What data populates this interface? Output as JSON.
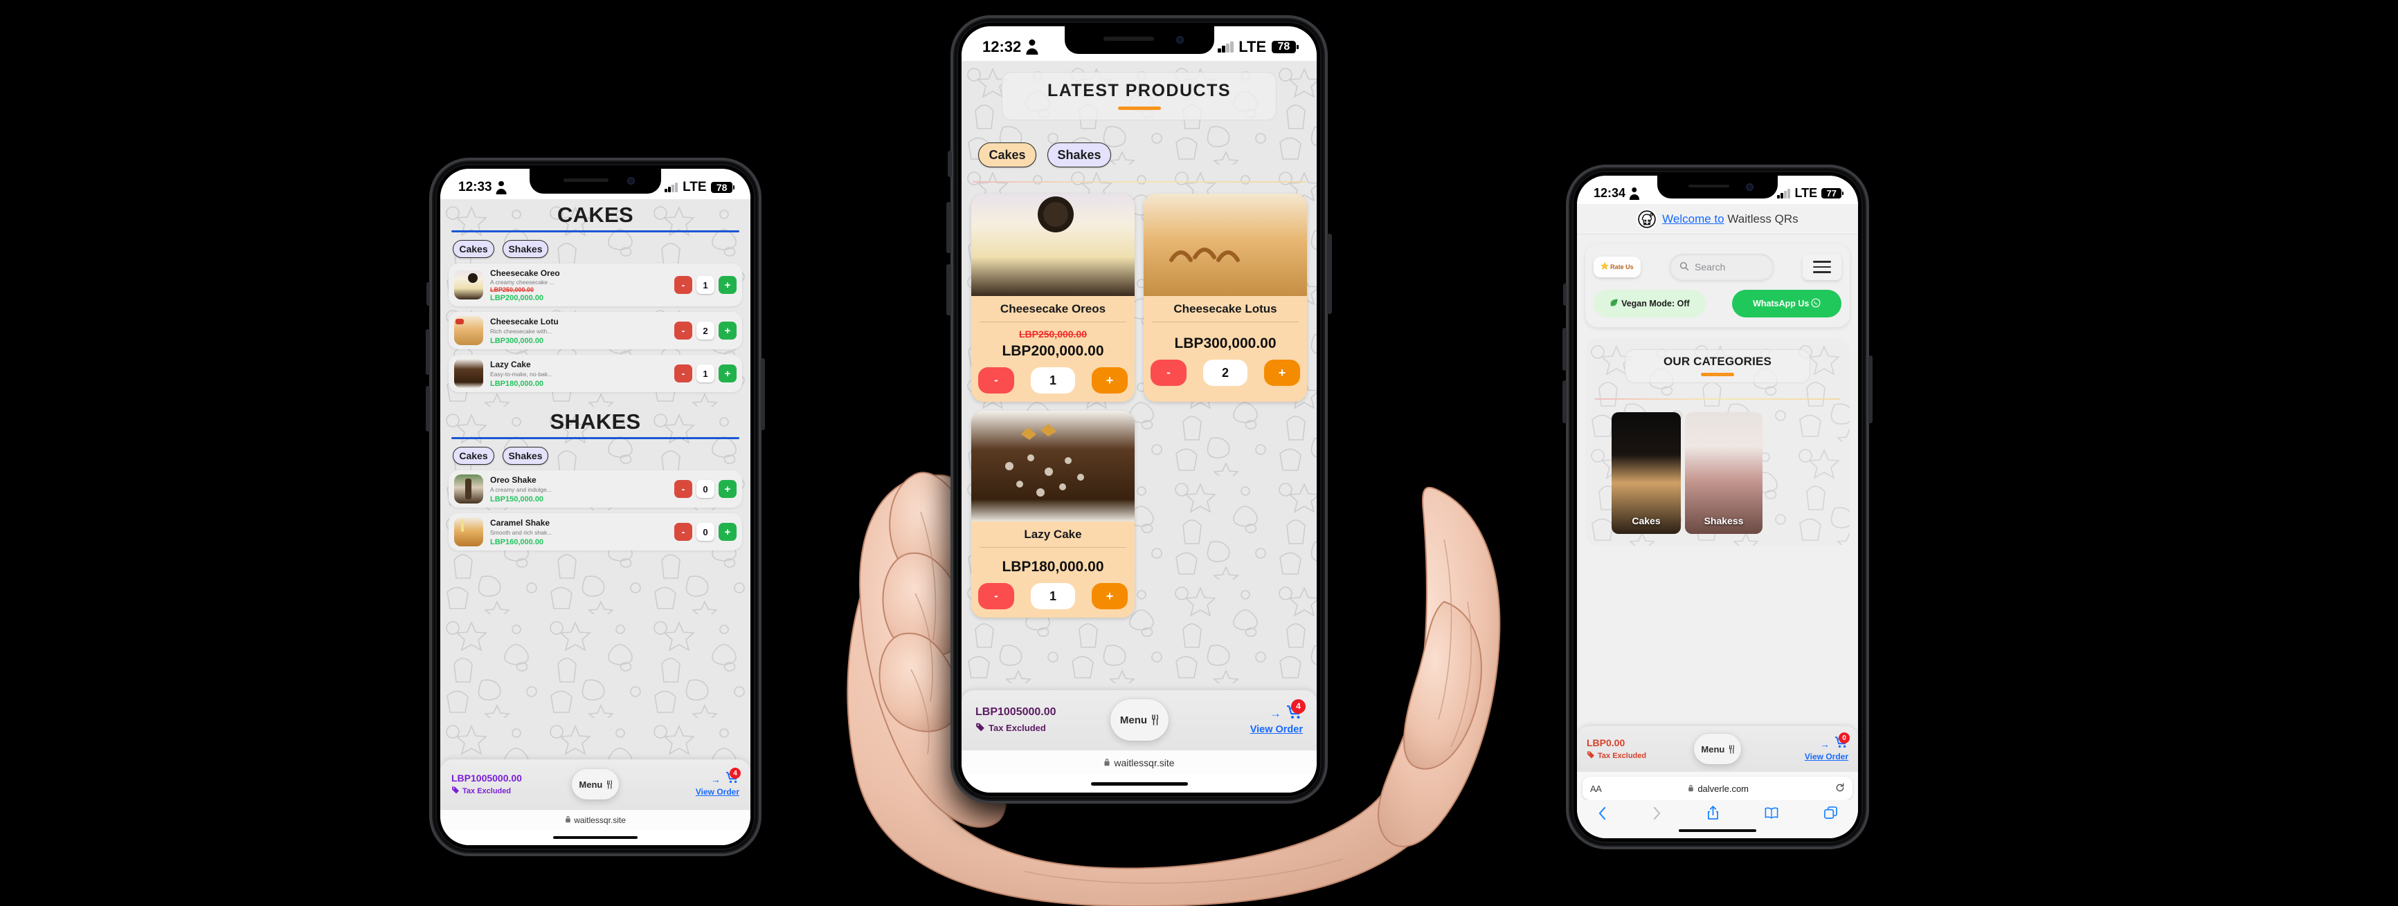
{
  "scene": {
    "background_color": "#000000",
    "phone_count": 3
  },
  "phone_left": {
    "status_bar": {
      "time": "12:33",
      "network": "LTE",
      "battery": "78",
      "person_icon": "person-icon"
    },
    "sections": [
      {
        "title": "CAKES",
        "chips": [
          {
            "label": "Cakes",
            "selected": false
          },
          {
            "label": "Shakes",
            "selected": false
          }
        ],
        "items": [
          {
            "name": "Cheesecake Oreo",
            "desc": "A creamy cheesecake ...",
            "old_price": "LBP250,000.00",
            "price": "LBP200,000.00",
            "qty": "1",
            "minus": "-",
            "plus": "+"
          },
          {
            "name": "Cheesecake Lotu",
            "desc": "Rich cheesecake with...",
            "old_price": "",
            "price": "LBP300,000.00",
            "qty": "2",
            "minus": "-",
            "plus": "+"
          },
          {
            "name": "Lazy Cake",
            "desc": "Easy-to-make, no-bak...",
            "old_price": "",
            "price": "LBP180,000.00",
            "qty": "1",
            "minus": "-",
            "plus": "+"
          }
        ]
      },
      {
        "title": "SHAKES",
        "chips": [
          {
            "label": "Cakes",
            "selected": false
          },
          {
            "label": "Shakes",
            "selected": false
          }
        ],
        "items": [
          {
            "name": "Oreo Shake",
            "desc": "A creamy and indulge...",
            "old_price": "",
            "price": "LBP150,000.00",
            "qty": "0",
            "minus": "-",
            "plus": "+"
          },
          {
            "name": "Caramel Shake",
            "desc": "Smooth and rich shak...",
            "old_price": "",
            "price": "LBP160,000.00",
            "qty": "0",
            "minus": "-",
            "plus": "+"
          }
        ]
      }
    ],
    "order_bar": {
      "total": "LBP1005000.00",
      "tax_note": "Tax Excluded",
      "menu_label": "Menu",
      "view_order": "View Order",
      "cart_badge": "4",
      "arrow": "→",
      "accent_color": "#7a1fd8"
    },
    "safari": {
      "lock": "lock-icon",
      "domain": "waitlessqr.site"
    }
  },
  "phone_center": {
    "status_bar": {
      "time": "12:32",
      "network": "LTE",
      "battery": "78",
      "person_icon": "person-icon"
    },
    "page_title": "LATEST PRODUCTS",
    "chips": [
      {
        "label": "Cakes",
        "selected": true
      },
      {
        "label": "Shakes",
        "selected": false
      }
    ],
    "products": [
      {
        "name": "Cheesecake Oreos",
        "old_price": "LBP250,000.00",
        "price": "LBP200,000.00",
        "qty": "1",
        "minus": "-",
        "plus": "+"
      },
      {
        "name": "Cheesecake Lotus",
        "old_price": "",
        "price": "LBP300,000.00",
        "qty": "2",
        "minus": "-",
        "plus": "+"
      },
      {
        "name": "Lazy Cake",
        "old_price": "",
        "price": "LBP180,000.00",
        "qty": "1",
        "minus": "-",
        "plus": "+"
      }
    ],
    "order_bar": {
      "total": "LBP1005000.00",
      "tax_note": "Tax Excluded",
      "menu_label": "Menu",
      "view_order": "View Order",
      "cart_badge": "4",
      "arrow": "→",
      "accent_color": "#5b1b63"
    },
    "safari": {
      "lock": "lock-icon",
      "domain": "waitlessqr.site"
    }
  },
  "phone_right": {
    "status_bar": {
      "time": "12:34",
      "network": "LTE",
      "battery": "77",
      "person_icon": "person-icon"
    },
    "site_header": {
      "link_text": "Welcome to",
      "title": "Waitless QRs",
      "logo": "chef-qr-logo"
    },
    "tools": {
      "rate_us": "Rate Us",
      "star_icon": "star-icon",
      "search_placeholder": "Search",
      "search_icon": "search-icon",
      "menu_icon": "hamburger-icon",
      "vegan_mode": "Vegan Mode: Off",
      "leaf_icon": "leaf-icon",
      "whatsapp": "WhatsApp Us",
      "whatsapp_icon": "whatsapp-icon",
      "whatsapp_color": "#20c75a"
    },
    "categories": {
      "title": "OUR CATEGORIES",
      "tiles": [
        {
          "label": "Cakes"
        },
        {
          "label": "Shakess"
        }
      ]
    },
    "order_bar": {
      "total": "LBP0.00",
      "tax_note": "Tax Excluded",
      "menu_label": "Menu",
      "view_order": "View Order",
      "cart_badge": "0",
      "arrow": "→",
      "accent_color": "#d9412b"
    },
    "safari": {
      "text_size_label": "AA",
      "lock": "lock-icon",
      "domain": "dalverle.com",
      "reload_icon": "reload-icon",
      "back_icon": "back-chevron-icon",
      "forward_icon": "forward-chevron-icon",
      "share_icon": "share-icon",
      "bookmarks_icon": "book-icon",
      "tabs_icon": "tabs-icon"
    }
  }
}
